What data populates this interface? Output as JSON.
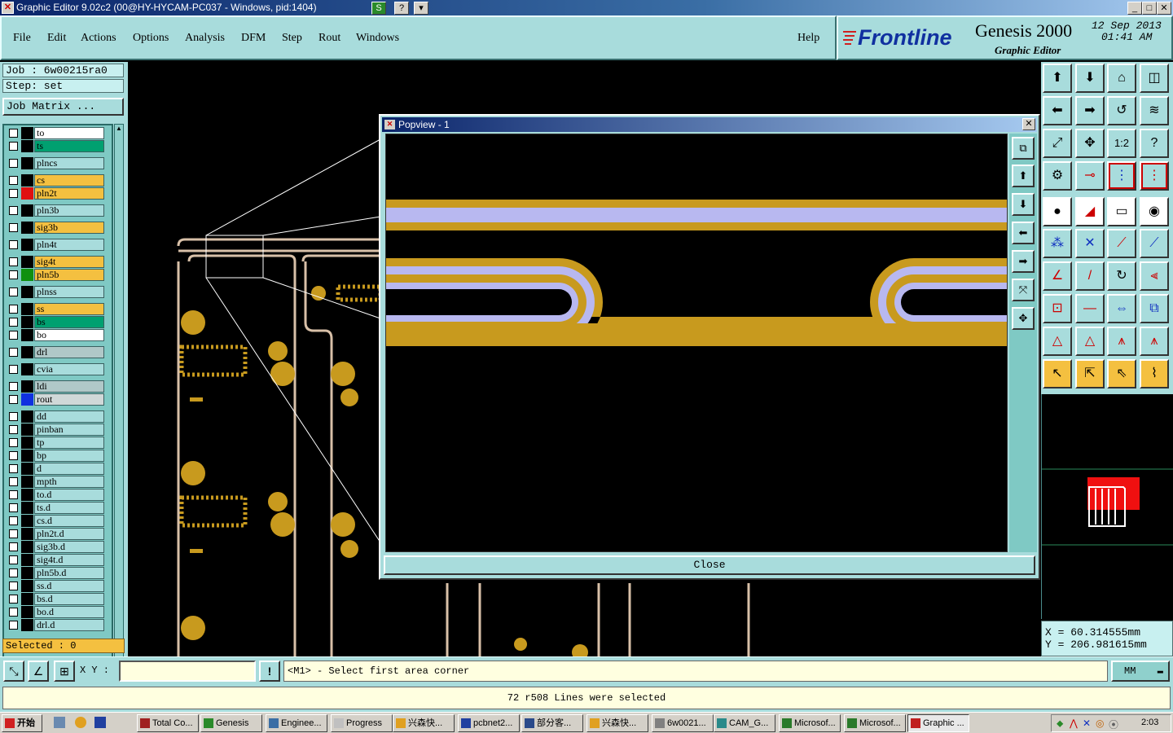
{
  "window": {
    "title": "Graphic Editor 9.02c2 (00@HY-HYCAM-PC037 - Windows, pid:1404)",
    "help_btn": "?",
    "s_btn": "S"
  },
  "menu": [
    "File",
    "Edit",
    "Actions",
    "Options",
    "Analysis",
    "DFM",
    "Step",
    "Rout",
    "Windows"
  ],
  "help": "Help",
  "brand": {
    "logo": "Frontline",
    "product": "Genesis 2000",
    "subtitle": "Graphic Editor",
    "date": "12 Sep 2013",
    "time": "01:41 AM"
  },
  "job": {
    "job_label": "Job : 6w00215ra0",
    "step_label": "Step: set",
    "matrix_btn": "Job Matrix ..."
  },
  "layers": [
    {
      "name": "to",
      "color": "#ffffff",
      "swatch": "#000000"
    },
    {
      "name": "ts",
      "color": "#00a070",
      "swatch": "#000000"
    },
    {
      "name": "plncs",
      "color": "#a8dcdc",
      "swatch": "#000000"
    },
    {
      "name": "cs",
      "color": "#f4c040",
      "swatch": "#000000"
    },
    {
      "name": "pln2t",
      "color": "#f4c040",
      "swatch": "#e01010"
    },
    {
      "name": "pln3b",
      "color": "#a8dcdc",
      "swatch": "#000000"
    },
    {
      "name": "sig3b",
      "color": "#f4c040",
      "swatch": "#000000"
    },
    {
      "name": "pln4t",
      "color": "#a8dcdc",
      "swatch": "#000000"
    },
    {
      "name": "sig4t",
      "color": "#f4c040",
      "swatch": "#000000"
    },
    {
      "name": "pln5b",
      "color": "#f4c040",
      "swatch": "#109010"
    },
    {
      "name": "plnss",
      "color": "#a8dcdc",
      "swatch": "#000000"
    },
    {
      "name": "ss",
      "color": "#f4c040",
      "swatch": "#000000"
    },
    {
      "name": "bs",
      "color": "#00a070",
      "swatch": "#000000"
    },
    {
      "name": "bo",
      "color": "#ffffff",
      "swatch": "#000000"
    },
    {
      "name": "drl",
      "color": "#b0c8c8",
      "swatch": "#000000"
    },
    {
      "name": "cvia",
      "color": "#a8dcdc",
      "swatch": "#000000"
    },
    {
      "name": "ldi",
      "color": "#b0c8c8",
      "swatch": "#000000"
    },
    {
      "name": "rout",
      "color": "#d0d8d8",
      "swatch": "#1030e0"
    },
    {
      "name": "dd",
      "color": "#a8dcdc",
      "swatch": "#000000"
    },
    {
      "name": "pinban",
      "color": "#a8dcdc",
      "swatch": "#000000"
    },
    {
      "name": "tp",
      "color": "#a8dcdc",
      "swatch": "#000000"
    },
    {
      "name": "bp",
      "color": "#a8dcdc",
      "swatch": "#000000"
    },
    {
      "name": "d",
      "color": "#a8dcdc",
      "swatch": "#000000"
    },
    {
      "name": "mpth",
      "color": "#a8dcdc",
      "swatch": "#000000"
    },
    {
      "name": "to.d",
      "color": "#a8dcdc",
      "swatch": "#000000"
    },
    {
      "name": "ts.d",
      "color": "#a8dcdc",
      "swatch": "#000000"
    },
    {
      "name": "cs.d",
      "color": "#a8dcdc",
      "swatch": "#000000"
    },
    {
      "name": "pln2t.d",
      "color": "#a8dcdc",
      "swatch": "#000000"
    },
    {
      "name": "sig3b.d",
      "color": "#a8dcdc",
      "swatch": "#000000"
    },
    {
      "name": "sig4t.d",
      "color": "#a8dcdc",
      "swatch": "#000000"
    },
    {
      "name": "pln5b.d",
      "color": "#a8dcdc",
      "swatch": "#000000"
    },
    {
      "name": "ss.d",
      "color": "#a8dcdc",
      "swatch": "#000000"
    },
    {
      "name": "bs.d",
      "color": "#a8dcdc",
      "swatch": "#000000"
    },
    {
      "name": "bo.d",
      "color": "#a8dcdc",
      "swatch": "#000000"
    },
    {
      "name": "drl.d",
      "color": "#a8dcdc",
      "swatch": "#000000"
    }
  ],
  "selected": "Selected : 0",
  "popview": {
    "title": "Popview - 1",
    "close": "Close"
  },
  "coords": {
    "x": "X  =  60.314555mm",
    "y": "Y  = 206.981615mm"
  },
  "command": {
    "xy_label": "X Y :",
    "prompt": "<M1> - Select first area corner",
    "units": "MM"
  },
  "status": "72 r508 Lines were selected",
  "taskbar": {
    "start": "开始",
    "tasks": [
      "Total Co...",
      "Genesis",
      "Enginee...",
      "Progress",
      "兴森快...",
      "pcbnet2...",
      "部分客...",
      "兴森快...",
      "6w0021...",
      "CAM_G...",
      "Microsof...",
      "Microsof...",
      "Graphic ..."
    ],
    "clock": "2:03"
  },
  "tools": {
    "ratio": "1:2",
    "help": "?"
  }
}
